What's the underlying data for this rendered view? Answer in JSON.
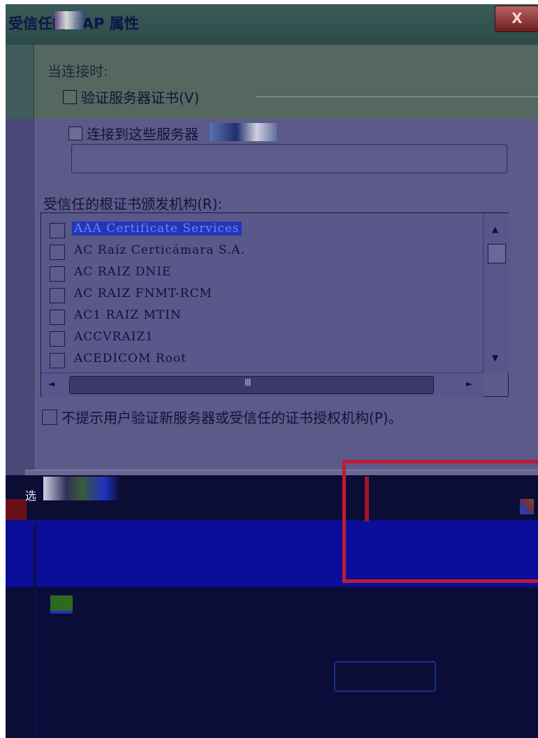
{
  "window": {
    "title": "受信任的 EAP 属性",
    "close_glyph": "X"
  },
  "on_connect": {
    "label": "当连接时:",
    "verify_server_cert": {
      "label": "验证服务器证书(V)",
      "checked": false
    },
    "connect_to_servers": {
      "label": "连接到这些服务器",
      "checked": false
    },
    "server_input": {
      "value": ""
    }
  },
  "root_ca": {
    "label": "受信任的根证书颁发机构(R):",
    "items": [
      {
        "label": "AAA Certificate Services",
        "checked": false,
        "selected": true
      },
      {
        "label": "AC Raíz Certicámara S.A.",
        "checked": false,
        "selected": false
      },
      {
        "label": "AC RAIZ DNIE",
        "checked": false,
        "selected": false
      },
      {
        "label": "AC RAIZ FNMT-RCM",
        "checked": false,
        "selected": false
      },
      {
        "label": "AC1 RAIZ MTIN",
        "checked": false,
        "selected": false
      },
      {
        "label": "ACCVRAIZ1",
        "checked": false,
        "selected": false
      },
      {
        "label": "ACEDICOM Root",
        "checked": false,
        "selected": false
      }
    ],
    "vscroll": {
      "up_glyph": "▲",
      "down_glyph": "▼",
      "position": 0.1
    },
    "hscroll": {
      "left_glyph": "◄",
      "right_glyph": "►",
      "grip_glyph": "III"
    }
  },
  "no_prompt": {
    "label": "不提示用户验证新服务器或受信任的证书授权机构(P)。",
    "checked": false
  },
  "lower_area": {
    "partial_label": "选"
  },
  "colors": {
    "title_bar": "#2c4a48",
    "panel": "#5c5a88",
    "selection": "#2236b8",
    "highlight_box": "#c01a34",
    "corrupted_band": "#0a0e98"
  }
}
